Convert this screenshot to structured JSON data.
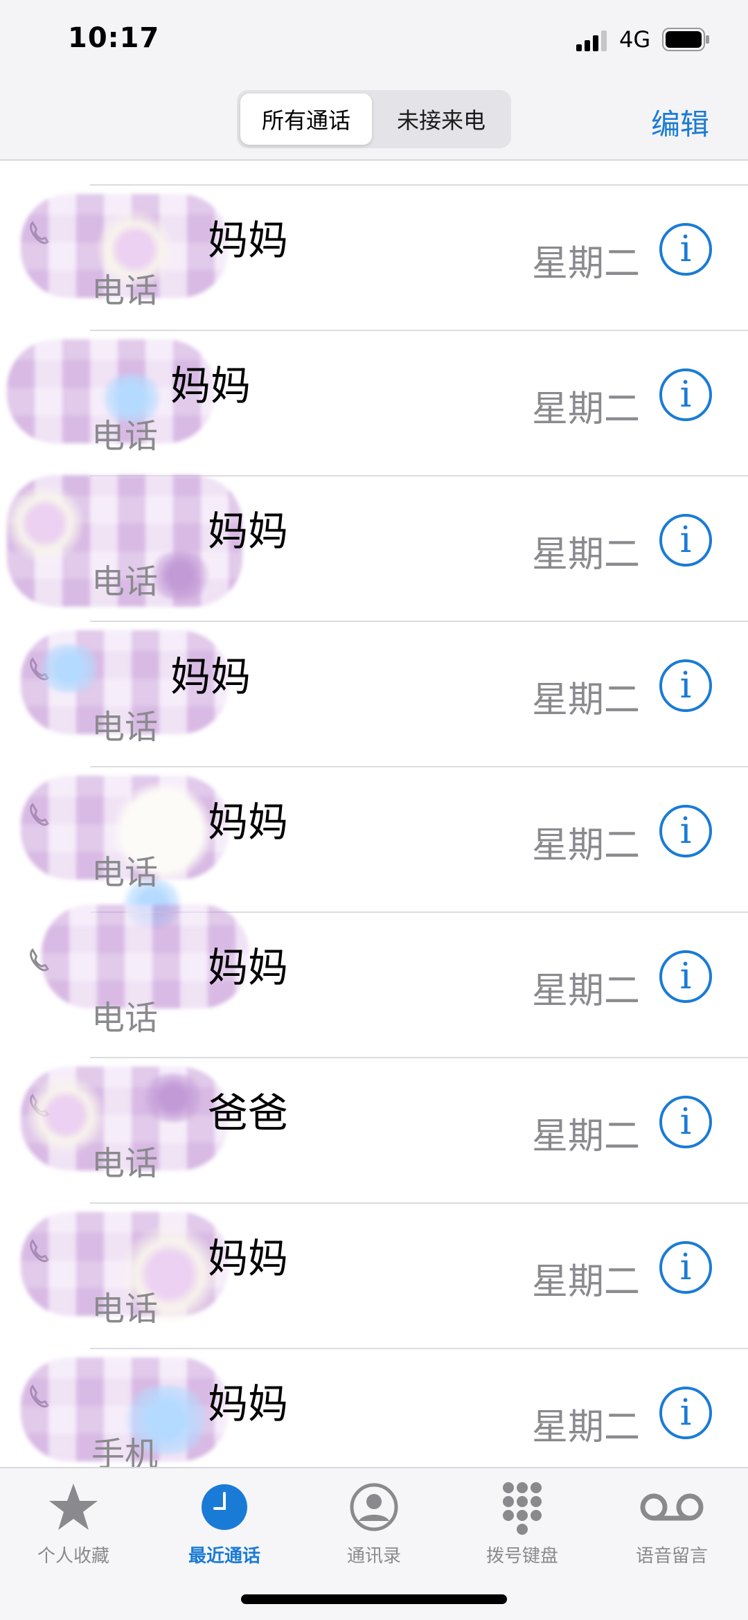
{
  "status_bar": {
    "time": "10:17",
    "network": "4G"
  },
  "header": {
    "segment_all": "所有通话",
    "segment_missed": "未接来电",
    "edit_label": "编辑"
  },
  "calls": [
    {
      "name": "妈妈",
      "type": "电话",
      "date": "星期二"
    },
    {
      "name": "妈妈",
      "type": "电话",
      "date": "星期二"
    },
    {
      "name": "妈妈",
      "type": "电话",
      "date": "星期二"
    },
    {
      "name": "妈妈",
      "type": "电话",
      "date": "星期二"
    },
    {
      "name": "妈妈",
      "type": "电话",
      "date": "星期二"
    },
    {
      "name": "妈妈",
      "type": "电话",
      "date": "星期二"
    },
    {
      "name": "爸爸",
      "type": "电话",
      "date": "星期二"
    },
    {
      "name": "妈妈",
      "type": "电话",
      "date": "星期二"
    },
    {
      "name": "妈妈",
      "type": "手机",
      "date": "星期二"
    }
  ],
  "tabs": [
    {
      "label": "个人收藏",
      "icon": "star-icon"
    },
    {
      "label": "最近通话",
      "icon": "clock-icon",
      "active": true
    },
    {
      "label": "通讯录",
      "icon": "person-circle-icon"
    },
    {
      "label": "拨号键盘",
      "icon": "keypad-icon"
    },
    {
      "label": "语音留言",
      "icon": "voicemail-icon"
    }
  ],
  "colors": {
    "accent": "#1a7bd6",
    "secondary_text": "#8a8a8e",
    "bar_bg": "#f4f4f6"
  }
}
